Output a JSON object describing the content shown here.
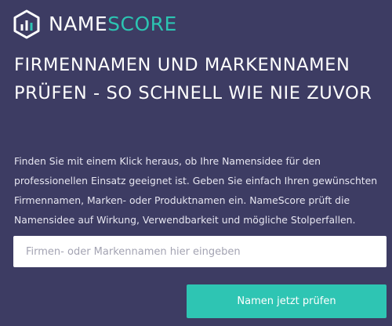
{
  "brand": {
    "name_part": "NAME",
    "score_part": "SCORE",
    "icon": "bar-chart-hexagon-icon",
    "colors": {
      "accent": "#2ec5b3",
      "background": "#3d3c63"
    }
  },
  "hero": {
    "headline": "FIRMENNAMEN UND MARKENNAMEN PRÜFEN - SO SCHNELL WIE NIE ZUVOR",
    "intro": "Finden Sie mit einem Klick heraus, ob Ihre Namensidee für den professionellen Einsatz geeignet ist. Geben Sie einfach Ihren gewünschten Firmennamen, Marken- oder Produktnamen ein. NameScore prüft die Namensidee auf Wirkung, Verwendbarkeit und mögliche Stolperfallen."
  },
  "form": {
    "input_value": "",
    "input_placeholder": "Firmen- oder Markennamen hier eingeben",
    "submit_label": "Namen jetzt prüfen"
  }
}
